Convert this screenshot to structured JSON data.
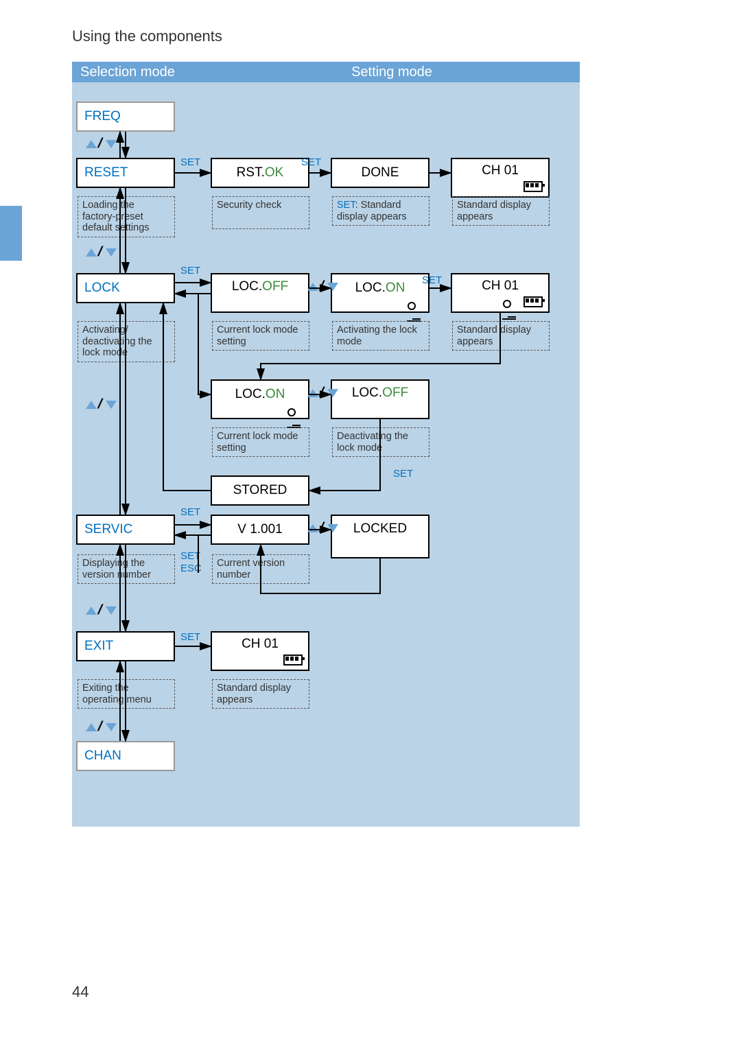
{
  "page": {
    "header": "Using the components",
    "number": "44"
  },
  "modes": {
    "selection": "Selection mode",
    "setting": "Setting mode"
  },
  "menu": {
    "freq": "FREQ",
    "reset": "RESET",
    "lock": "LOCK",
    "servic": "SERVIC",
    "exit": "EXIT",
    "chan": "CHAN"
  },
  "states": {
    "rst_pre": "RST.",
    "rst_ok": "OK",
    "done": "DONE",
    "ch01": "CH 01",
    "loc_pre": "LOC.",
    "loc_off": "OFF",
    "loc_on": "ON",
    "stored": "STORED",
    "version": "V 1.001",
    "locked": "LOCKED"
  },
  "captions": {
    "reset": "Loading the factory-preset default settings",
    "security": "Security check",
    "done_pre": "SET",
    "done": ": Standard display appears",
    "std": "Standard display appears",
    "lock": "Activating/ deactivating the lock mode",
    "lock_cur": "Current lock mode setting",
    "lock_act": "Activating the lock mode",
    "lock_deact": "Deactivating the lock mode",
    "servic": "Displaying the version number",
    "version": "Current version number",
    "exit": "Exiting the operating menu"
  },
  "labels": {
    "set": "SET",
    "esc": "ESC"
  }
}
